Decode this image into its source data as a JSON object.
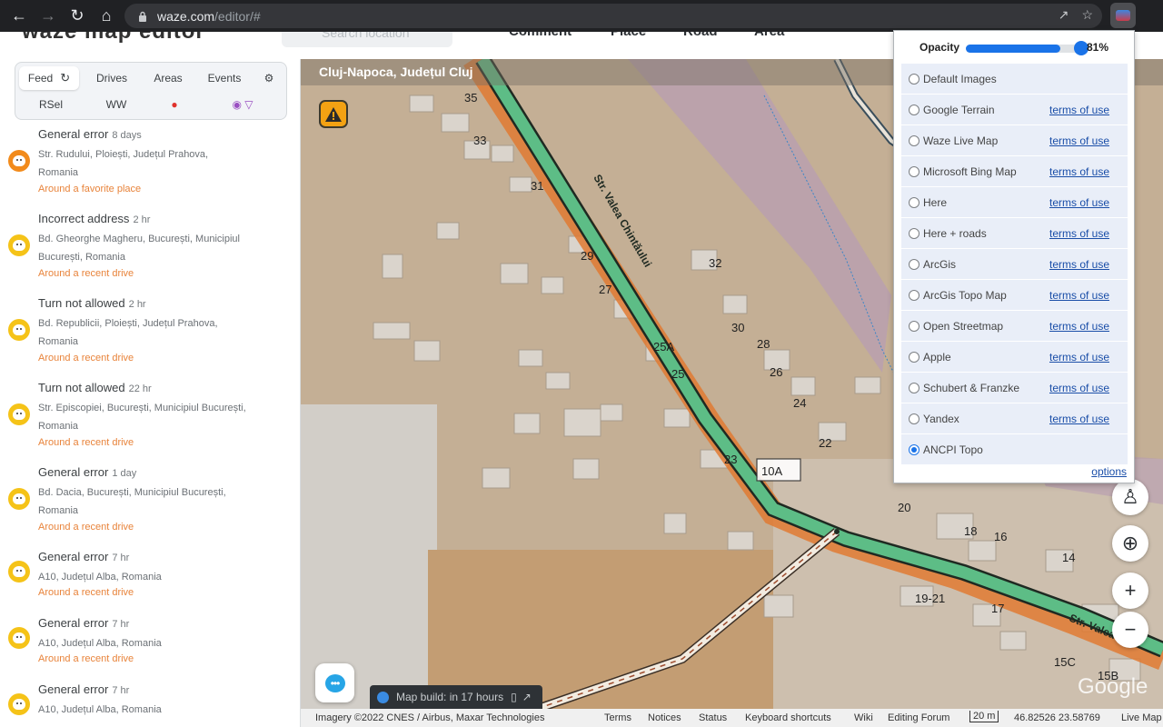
{
  "browser": {
    "url_host": "waze.com",
    "url_path": "/editor/#"
  },
  "wme": {
    "logo": "waze map editor",
    "search_placeholder": "Search location",
    "tools": [
      "Comment",
      "Place",
      "Road",
      "Area"
    ]
  },
  "sidebar": {
    "tabs": [
      "Feed",
      "Drives",
      "Areas",
      "Events",
      "RSel",
      "WW"
    ],
    "feed": [
      {
        "title": "General error",
        "time": "8 days",
        "address": "Str. Rudului, Ploiești, Județul Prahova, Romania",
        "context": "Around a favorite place",
        "color": "#f28b1c"
      },
      {
        "title": "Incorrect address",
        "time": "2 hr",
        "address": "Bd. Gheorghe Magheru, București, Municipiul București, Romania",
        "context": "Around a recent drive",
        "color": "#f5c318"
      },
      {
        "title": "Turn not allowed",
        "time": "2 hr",
        "address": "Bd. Republicii, Ploiești, Județul Prahova, Romania",
        "context": "Around a recent drive",
        "color": "#f5c318"
      },
      {
        "title": "Turn not allowed",
        "time": "22 hr",
        "address": "Str. Episcopiei, București, Municipiul București, Romania",
        "context": "Around a recent drive",
        "color": "#f5c318"
      },
      {
        "title": "General error",
        "time": "1 day",
        "address": "Bd. Dacia, București, Municipiul București, Romania",
        "context": "Around a recent drive",
        "color": "#f5c318"
      },
      {
        "title": "General error",
        "time": "7 hr",
        "address": "A10, Județul Alba, Romania",
        "context": "Around a recent drive",
        "color": "#f5c318"
      },
      {
        "title": "General error",
        "time": "7 hr",
        "address": "A10, Județul Alba, Romania",
        "context": "Around a recent drive",
        "color": "#f5c318"
      },
      {
        "title": "General error",
        "time": "7 hr",
        "address": "A10, Județul Alba, Romania",
        "context": "",
        "color": "#f5c318"
      }
    ]
  },
  "map": {
    "location": "Cluj-Napoca, Județul Cluj",
    "street_name": "Str. Valea Chintăului",
    "street_name_right": "Str. Valea",
    "house_numbers": [
      "35",
      "33",
      "31",
      "29",
      "27",
      "32",
      "30",
      "28",
      "26",
      "25A",
      "25",
      "24",
      "23",
      "22",
      "10A",
      "20",
      "18",
      "16",
      "14",
      "19-21",
      "17",
      "15C",
      "15B"
    ],
    "map_build": "Map build: in 17 hours",
    "google": "Google"
  },
  "footer": {
    "imagery": "Imagery ©2022 CNES / Airbus, Maxar Technologies",
    "links": [
      "Terms",
      "Notices",
      "Status",
      "Keyboard shortcuts",
      "Wiki",
      "Editing Forum"
    ],
    "scale": "20 m",
    "coords": "46.82526 23.58769",
    "live_map": "Live Map"
  },
  "imagery_panel": {
    "opacity_label": "Opacity",
    "opacity_value": "81%",
    "opacity": 0.81,
    "terms_label": "terms of use",
    "options_label": "options",
    "sources": [
      {
        "name": "Default Images",
        "terms": false,
        "selected": false
      },
      {
        "name": "Google Terrain",
        "terms": true,
        "selected": false
      },
      {
        "name": "Waze Live Map",
        "terms": true,
        "selected": false
      },
      {
        "name": "Microsoft Bing Map",
        "terms": true,
        "selected": false
      },
      {
        "name": "Here",
        "terms": true,
        "selected": false
      },
      {
        "name": "Here + roads",
        "terms": true,
        "selected": false
      },
      {
        "name": "ArcGis",
        "terms": true,
        "selected": false
      },
      {
        "name": "ArcGis Topo Map",
        "terms": true,
        "selected": false
      },
      {
        "name": "Open Streetmap",
        "terms": true,
        "selected": false
      },
      {
        "name": "Apple",
        "terms": true,
        "selected": false
      },
      {
        "name": "Schubert & Franzke",
        "terms": true,
        "selected": false
      },
      {
        "name": "Yandex",
        "terms": true,
        "selected": false
      },
      {
        "name": "ANCPI Topo",
        "terms": false,
        "selected": true
      }
    ]
  }
}
